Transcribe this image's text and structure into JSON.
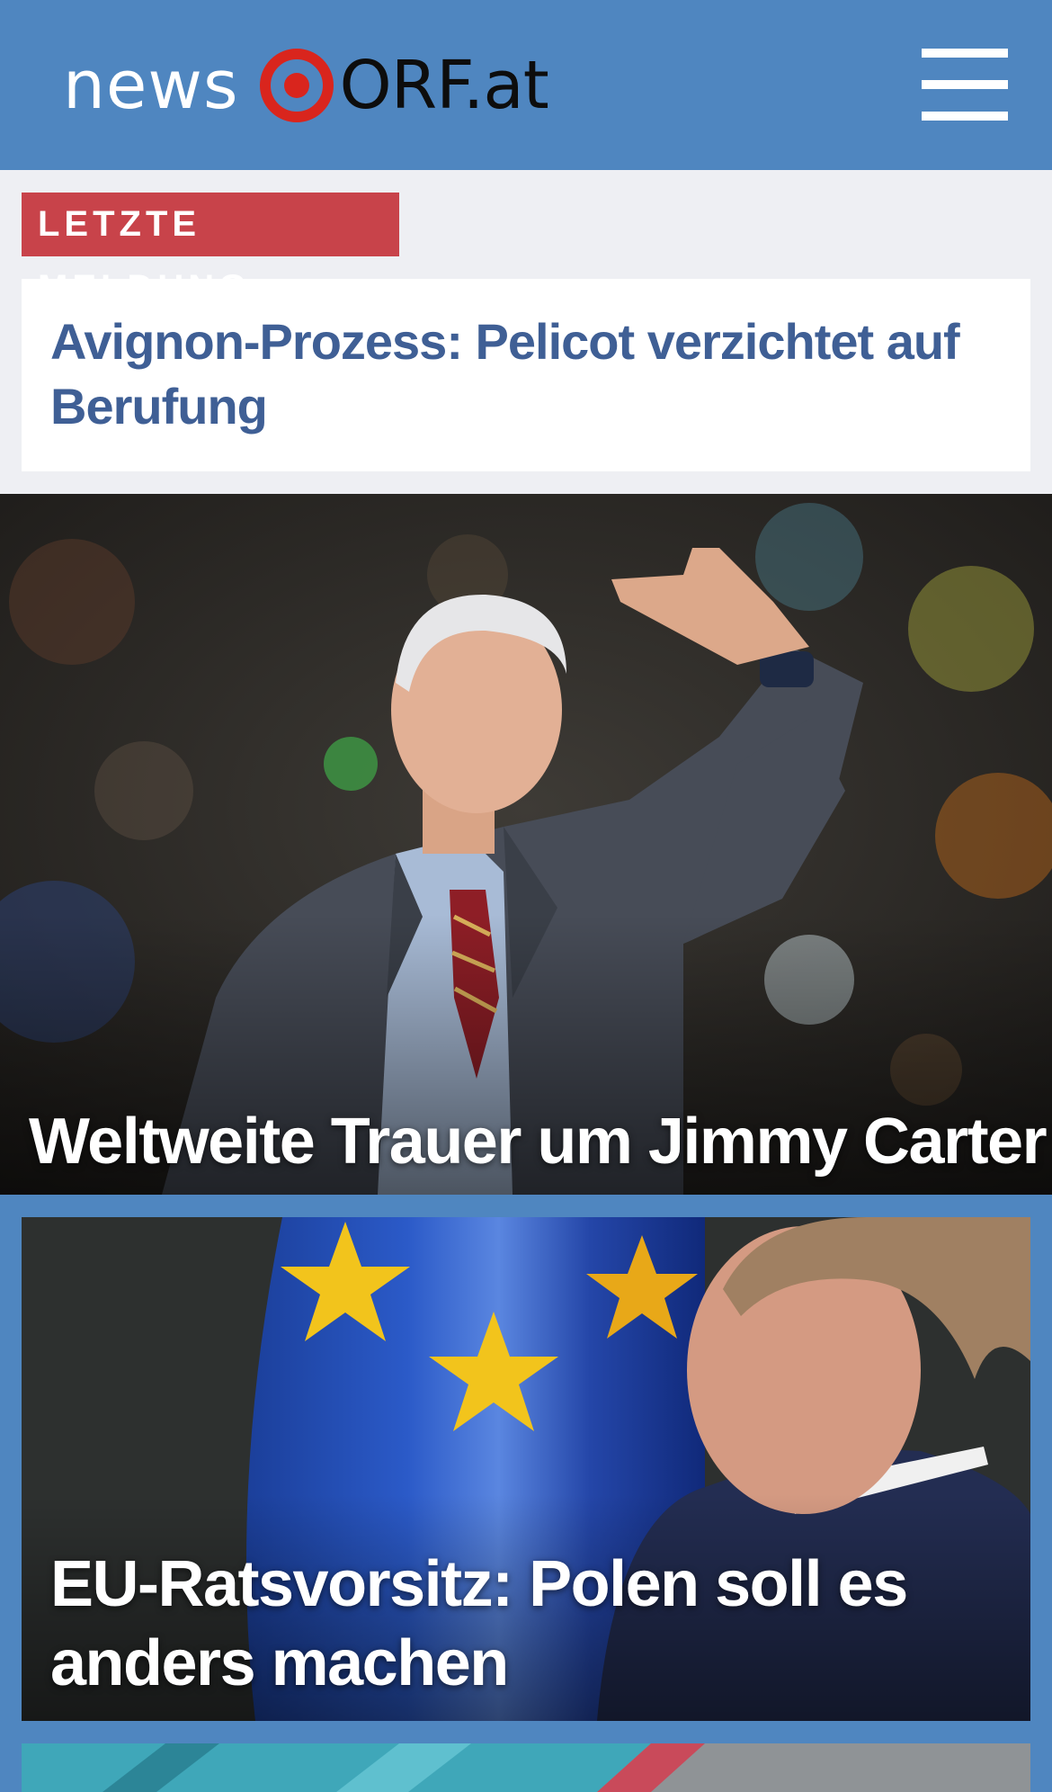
{
  "header": {
    "logo_news": "news",
    "logo_orf": "ORF.at",
    "menu_icon": "hamburger-menu-icon",
    "background_color": "#4f86c0"
  },
  "breaking": {
    "badge_label": "LETZTE MELDUNG",
    "badge_color": "#c8434a",
    "title": "Avignon-Prozess: Pelicot verzichtet auf Berufung",
    "title_color": "#3f5f95"
  },
  "stories": [
    {
      "title": "Weltweite Trauer um Jimmy Carter"
    },
    {
      "title": "EU-Ratsvorsitz: Polen soll es anders machen"
    }
  ]
}
